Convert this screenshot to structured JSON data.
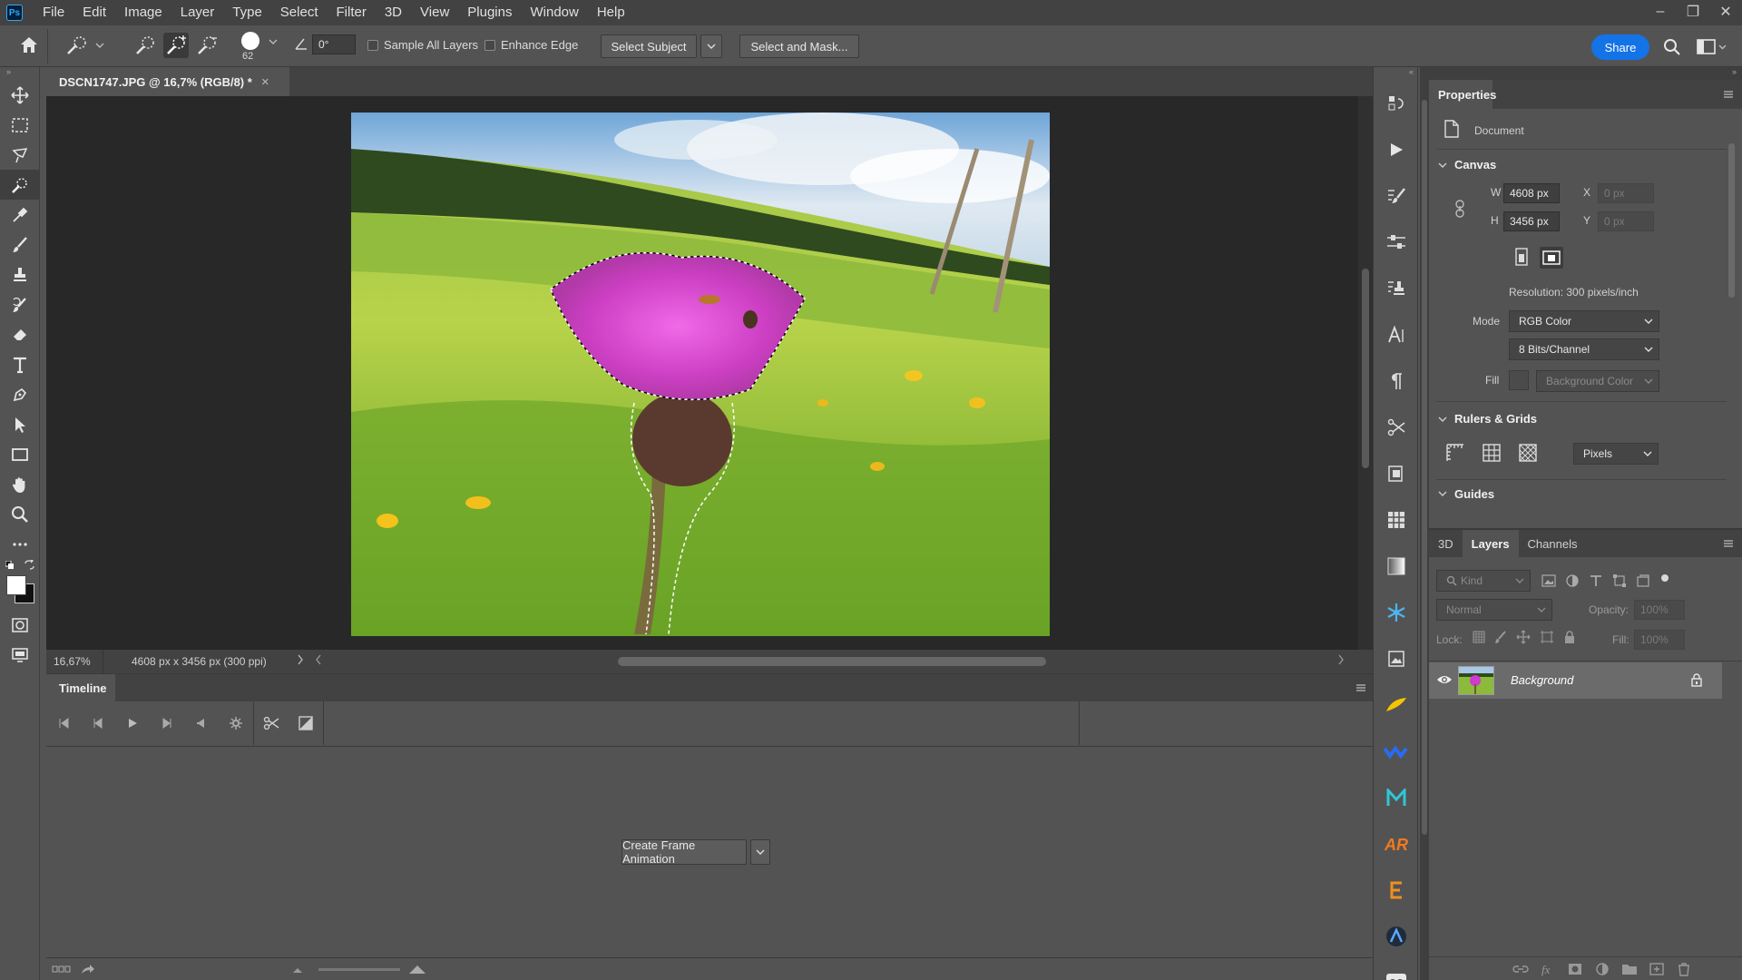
{
  "app": {
    "logo": "Ps"
  },
  "menu": [
    "File",
    "Edit",
    "Image",
    "Layer",
    "Type",
    "Select",
    "Filter",
    "3D",
    "View",
    "Plugins",
    "Window",
    "Help"
  ],
  "window_controls": {
    "minimize": "–",
    "restore": "❐",
    "close": "✕"
  },
  "options": {
    "brush_size": "62",
    "angle": "0°",
    "sample_all_layers": "Sample All Layers",
    "enhance_edge": "Enhance Edge",
    "select_subject": "Select Subject",
    "select_and_mask": "Select and Mask...",
    "share": "Share"
  },
  "document": {
    "tab_title": "DSCN1747.JPG @ 16,7% (RGB/8) *",
    "close": "×",
    "zoom": "16,67%",
    "info": "4608 px x 3456 px (300 ppi)"
  },
  "timeline": {
    "title": "Timeline",
    "create_button": "Create Frame Animation"
  },
  "properties": {
    "title": "Properties",
    "doc_label": "Document",
    "canvas_section": "Canvas",
    "w_label": "W",
    "w_value": "4608 px",
    "h_label": "H",
    "h_value": "3456 px",
    "x_label": "X",
    "x_value": "0 px",
    "y_label": "Y",
    "y_value": "0 px",
    "resolution": "Resolution: 300 pixels/inch",
    "mode_label": "Mode",
    "mode_value": "RGB Color",
    "bits_value": "8 Bits/Channel",
    "fill_label": "Fill",
    "fill_value": "Background Color",
    "rulers_section": "Rulers & Grids",
    "units_value": "Pixels",
    "guides_section": "Guides"
  },
  "layers_panel": {
    "tabs": [
      "3D",
      "Layers",
      "Channels"
    ],
    "active_tab": "Layers",
    "kind_placeholder": "Kind",
    "blend_mode": "Normal",
    "opacity_label": "Opacity:",
    "opacity_value": "100%",
    "lock_label": "Lock:",
    "fill_label": "Fill:",
    "fill_value": "100%",
    "layers": [
      {
        "name": "Background",
        "visible": true,
        "locked": true
      }
    ]
  },
  "colors": {
    "accent": "#1473e6",
    "panel_bg": "#535353",
    "dark_bg": "#424242",
    "canvas_bg": "#282828"
  }
}
